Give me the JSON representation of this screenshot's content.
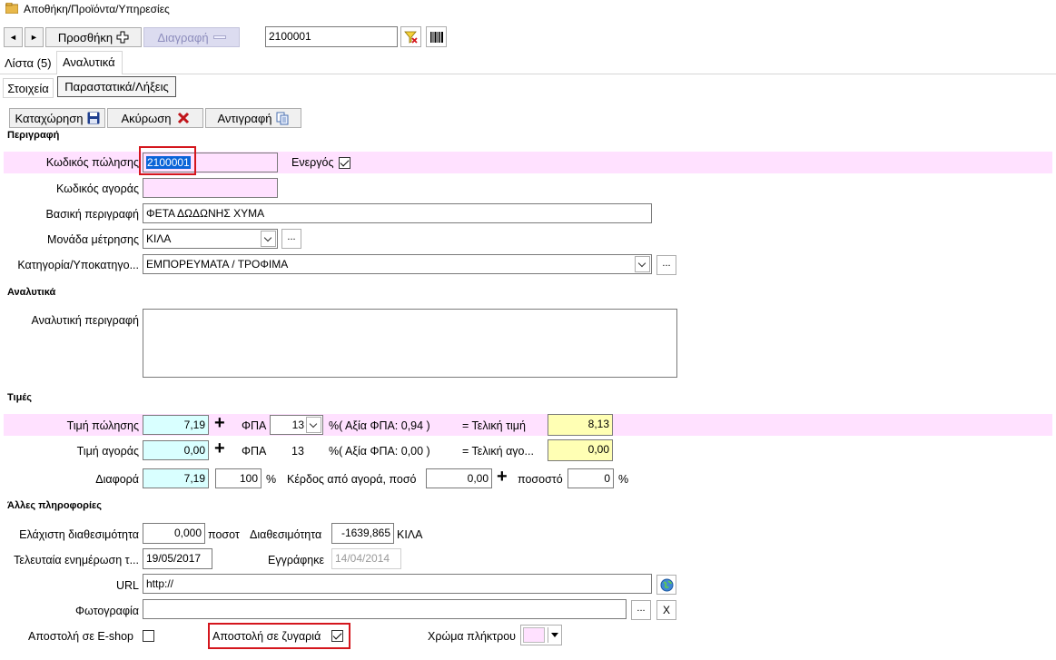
{
  "window": {
    "title": "Αποθήκη/Προϊόντα/Υπηρεσίες"
  },
  "toolbar": {
    "prev_label": "◄",
    "next_label": "►",
    "add_label": "Προσθήκη",
    "delete_label": "Διαγραφή",
    "search_value": "2100001"
  },
  "tabs": {
    "list_label": "Λίστα (5)",
    "details_label": "Αναλυτικά"
  },
  "subtabs": {
    "info_label": "Στοιχεία",
    "docs_label": "Παραστατικά/Λήξεις"
  },
  "actions": {
    "save_label": "Καταχώρηση",
    "cancel_label": "Ακύρωση",
    "copy_label": "Αντιγραφή"
  },
  "description": {
    "section_label": "Περιγραφή",
    "sale_code_label": "Κωδικός πώλησης",
    "sale_code_value": "2100001",
    "active_label": "Ενεργός",
    "active_checked": true,
    "purchase_code_label": "Κωδικός αγοράς",
    "purchase_code_value": "",
    "basic_desc_label": "Βασική περιγραφή",
    "basic_desc_value": "ΦΕΤΑ ΔΩΔΩΝΗΣ ΧΥΜΑ",
    "unit_label": "Μονάδα μέτρησης",
    "unit_value": "ΚΙΛΑ",
    "category_label": "Κατηγορία/Υποκατηγο...",
    "category_value": "ΕΜΠΟΡΕΥΜΑΤΑ / ΤΡΟΦΙΜΑ"
  },
  "details": {
    "section_label": "Αναλυτικά",
    "long_desc_label": "Αναλυτική περιγραφή",
    "long_desc_value": ""
  },
  "prices": {
    "section_label": "Τιμές",
    "sale_price_label": "Τιμή πώλησης",
    "sale_price_value": "7,19",
    "vat_label": "ΦΠΑ",
    "vat_sale_value": "13",
    "vat_sale_info": "%( Αξία ΦΠΑ: 0,94 )",
    "final_price_label": "= Τελική τιμή",
    "final_price_value": "8,13",
    "purchase_price_label": "Τιμή αγοράς",
    "purchase_price_value": "0,00",
    "vat_purchase_value": "13",
    "vat_purchase_info": "%( Αξία ΦΠΑ: 0,00 )",
    "final_purchase_label": "= Τελική αγο...",
    "final_purchase_value": "0,00",
    "difference_label": "Διαφορά",
    "difference_value": "7,19",
    "difference_percent": "100",
    "percent_sign": "%",
    "profit_label": "Κέρδος από αγορά, ποσό",
    "profit_value": "0,00",
    "percent_label": "ποσοστό",
    "percent_value": "0"
  },
  "other": {
    "section_label": "Άλλες πληροφορίες",
    "min_avail_label": "Ελάχιστη διαθεσιμότητα",
    "min_avail_value": "0,000",
    "qty_unit": "ποσοτ",
    "avail_label": "Διαθεσιμότητα",
    "avail_value": "-1639,865",
    "avail_unit": "ΚΙΛΑ",
    "last_update_label": "Τελευταία ενημέρωση τ...",
    "last_update_value": "19/05/2017",
    "registered_label": "Εγγράφηκε",
    "registered_value": "14/04/2014",
    "url_label": "URL",
    "url_value": "http://",
    "photo_label": "Φωτογραφία",
    "photo_value": "",
    "clear_label": "X",
    "eshop_label": "Αποστολή σε E-shop",
    "eshop_checked": false,
    "scale_label": "Αποστολή σε ζυγαριά",
    "scale_checked": true,
    "key_color_label": "Χρώμα πλήκτρου",
    "key_color_value": "#ffe1ff"
  },
  "colors": {
    "highlight_row": "#ffe1ff",
    "price_cyan": "#d9ffff",
    "final_yellow": "#ffffb4",
    "annotation_red": "#d4161d"
  }
}
